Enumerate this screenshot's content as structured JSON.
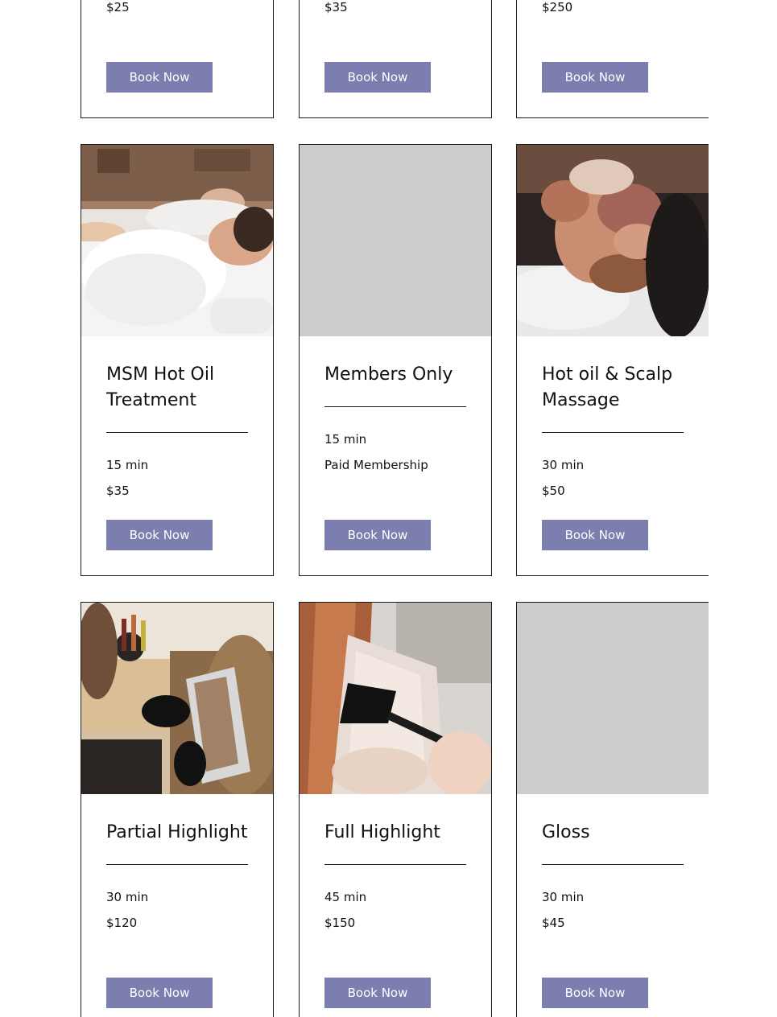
{
  "accent_color": "#7b7eaf",
  "placeholder_color": "#cccccc",
  "row_top": [
    {
      "price": "$25",
      "button": "Book Now"
    },
    {
      "price": "$35",
      "button": "Book Now"
    },
    {
      "price": "$250",
      "button": "Book Now"
    }
  ],
  "row_middle": [
    {
      "image": "spa-robes-photo",
      "title": "MSM Hot Oil Treatment",
      "duration": "15 min",
      "price": "$35",
      "button": "Book Now"
    },
    {
      "image": "placeholder",
      "title": "Members Only",
      "duration": "15 min",
      "price": "Paid Membership",
      "button": "Book Now"
    },
    {
      "image": "scalp-massage-photo",
      "title": "Hot oil & Scalp Massage",
      "duration": "30 min",
      "price": "$50",
      "button": "Book Now"
    }
  ],
  "row_bottom": [
    {
      "image": "highlight-foil-photo",
      "title": "Partial Highlight",
      "duration": "30 min",
      "price": "$120",
      "button": "Book Now"
    },
    {
      "image": "color-brush-photo",
      "title": "Full Highlight",
      "duration": "45 min",
      "price": "$150",
      "button": "Book Now"
    },
    {
      "image": "placeholder",
      "title": "Gloss",
      "duration": "30 min",
      "price": "$45",
      "button": "Book Now"
    }
  ]
}
